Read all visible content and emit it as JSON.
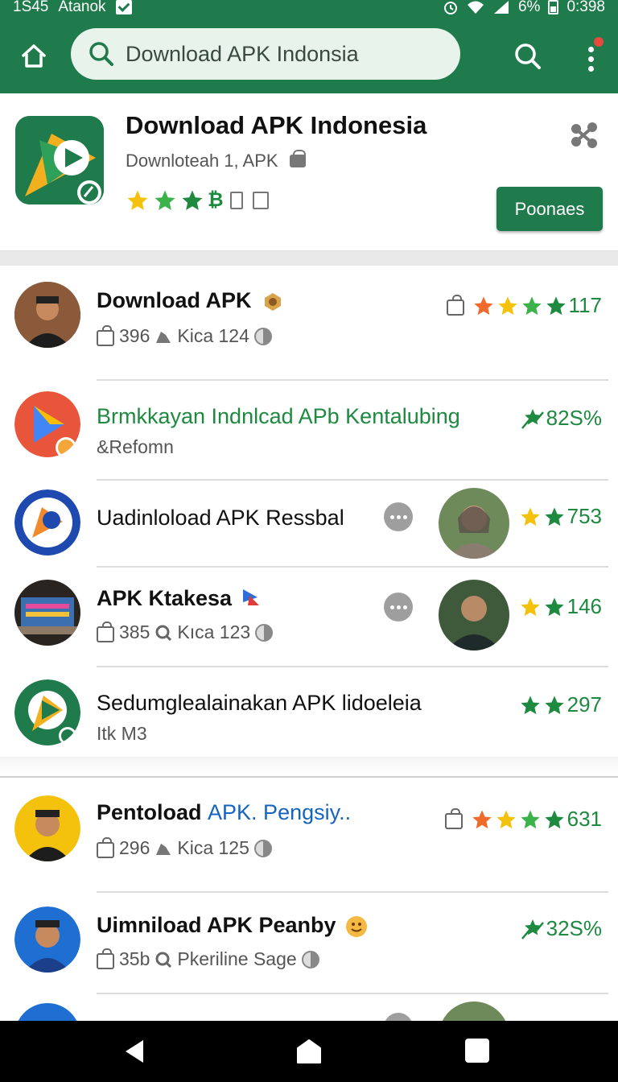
{
  "status_bar": {
    "time_left": "1S45",
    "carrier": "Atanok",
    "battery": "6%",
    "time_right": "0:398"
  },
  "search": {
    "query": "Download APK Indonsia"
  },
  "header": {
    "title": "Download APK Indonesia",
    "subtitle": "Downloteah 1, APK",
    "install_label": "Poonaes",
    "rating_glyph": "₿"
  },
  "rows": [
    {
      "title": "Download APK",
      "meta_count": "396",
      "meta_label": "Kica 124",
      "rating": "117"
    },
    {
      "title": "Brmkkayan Indnlcad APb Kentalubing",
      "meta_label": "&Refomn",
      "rating": "82S%"
    },
    {
      "title": "Uadinloload APK Ressbal",
      "rating": "753"
    },
    {
      "title": "APK Ktakesa",
      "meta_count": "385",
      "meta_label": "Kıca 123",
      "rating": "146"
    },
    {
      "title": "Sedumglealainakan APK lidoeleia",
      "meta_label": "Itk M3",
      "rating": "297"
    },
    {
      "title_main": "Pentoload",
      "title_blue": "APK. Pengsiy..",
      "meta_count": "296",
      "meta_label": "Kica 125",
      "rating": "631"
    },
    {
      "title": "Uimniload APK Peanby",
      "meta_count": "35b",
      "meta_label": "Pkeriline Sage",
      "rating": "32S%"
    }
  ],
  "colors": {
    "primary": "#1f7a4c",
    "rating_green": "#1d8a3f",
    "star_yellow": "#f4c20d",
    "star_orange": "#f06a2b",
    "link_blue": "#1565c0"
  },
  "icons": [
    "home-icon",
    "search-icon",
    "more-vert-icon",
    "share-icon",
    "star-icon",
    "bag-icon",
    "more-horizontal-icon",
    "back-icon",
    "home-nav-icon",
    "recents-icon"
  ]
}
